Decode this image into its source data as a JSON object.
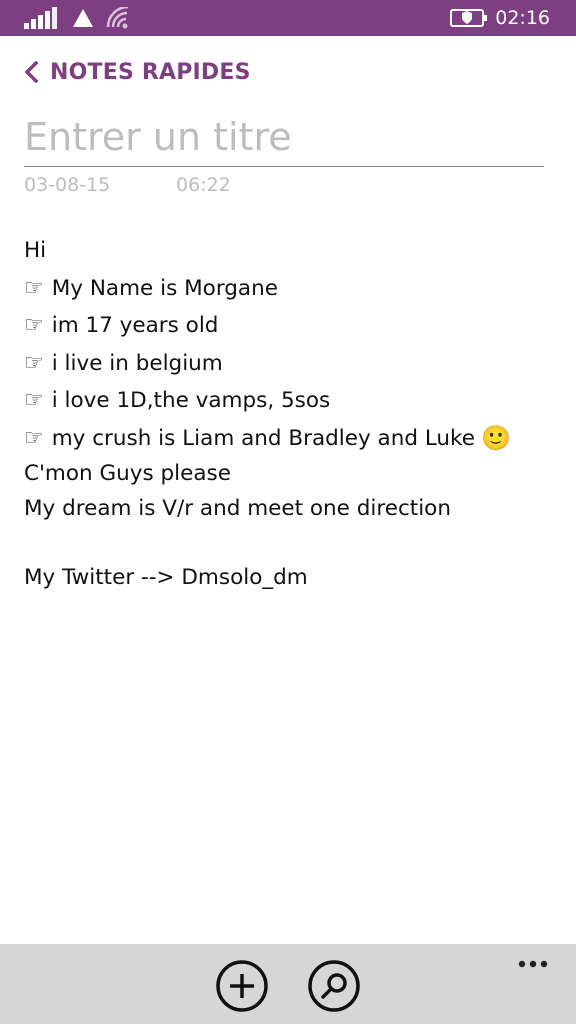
{
  "status_bar": {
    "time": "02:16",
    "signal_icon": "signal-bars-icon",
    "network_icon": "network-triangle-icon",
    "wifi_icon": "wifi-icon",
    "battery_icon": "battery-saver-icon"
  },
  "header": {
    "back_icon": "chevron-left-icon",
    "title": "NOTES RAPIDES"
  },
  "note": {
    "title_placeholder": "Entrer un titre",
    "title_value": "",
    "date": "03-08-15",
    "time": "06:22",
    "lines": [
      "Hi",
      "My Name is Morgane",
      "im 17 years old",
      "i live in belgium",
      "i love 1D,the vamps, 5sos",
      "my crush is Liam and Bradley and Luke",
      "C'mon Guys please",
      "My dream is V/r and meet one direction",
      "My Twitter --> Dmsolo_dm"
    ],
    "pointing_emoji": "☞",
    "smiley_emoji": "🙂"
  },
  "app_bar": {
    "add_icon": "add-circle-icon",
    "search_icon": "search-circle-icon",
    "more_icon": "more-ellipsis-icon"
  },
  "colors": {
    "accent": "#7e3f82",
    "app_bar_bg": "#d6d6d6",
    "placeholder": "#bdbdbd"
  }
}
